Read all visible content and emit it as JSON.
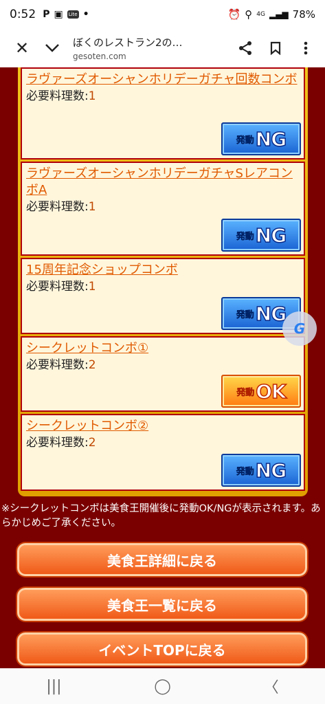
{
  "status": {
    "time": "0:52",
    "icons_left": [
      "P",
      "▣",
      "Lite",
      "•"
    ],
    "battery": "78%",
    "network": "4G"
  },
  "browser": {
    "close_icon": "✕",
    "dropdown_icon": "⌄",
    "title": "ぼくのレストラン2の…",
    "url": "gesoten.com",
    "share_icon": "share",
    "bookmark_icon": "bookmark",
    "menu_icon": "more"
  },
  "combos": [
    {
      "name": "ラヴァーズオーシャンホリデーガチャ回数コンボ",
      "req_label": "必要料理数:",
      "req_value": "1",
      "badge_kanji": "発動",
      "badge_word": "NG",
      "status": "ng"
    },
    {
      "name": "ラヴァーズオーシャンホリデーガチャSレアコンボA",
      "req_label": "必要料理数:",
      "req_value": "1",
      "badge_kanji": "発動",
      "badge_word": "NG",
      "status": "ng"
    },
    {
      "name": "15周年記念ショップコンボ",
      "req_label": "必要料理数:",
      "req_value": "1",
      "badge_kanji": "発動",
      "badge_word": "NG",
      "status": "ng"
    },
    {
      "name": "シークレットコンボ①",
      "req_label": "必要料理数:",
      "req_value": "2",
      "badge_kanji": "発動",
      "badge_word": "OK",
      "status": "ok"
    },
    {
      "name": "シークレットコンボ②",
      "req_label": "必要料理数:",
      "req_value": "2",
      "badge_kanji": "発動",
      "badge_word": "NG",
      "status": "ng"
    }
  ],
  "note": "※シークレットコンボは美食王開催後に発動OK/NGが表示されます。あらかじめご了承ください。",
  "buttons": {
    "detail": "美食王詳細に戻る",
    "list": "美食王一覧に戻る",
    "top": "イベントTOPに戻る"
  },
  "float_button": "G",
  "navbar": {
    "recent": "|||",
    "home": "◯",
    "back": "〈"
  },
  "colors": {
    "background": "#7a0000",
    "link": "#e05a00",
    "button": "#f05a18",
    "frame": "#e0a000"
  }
}
